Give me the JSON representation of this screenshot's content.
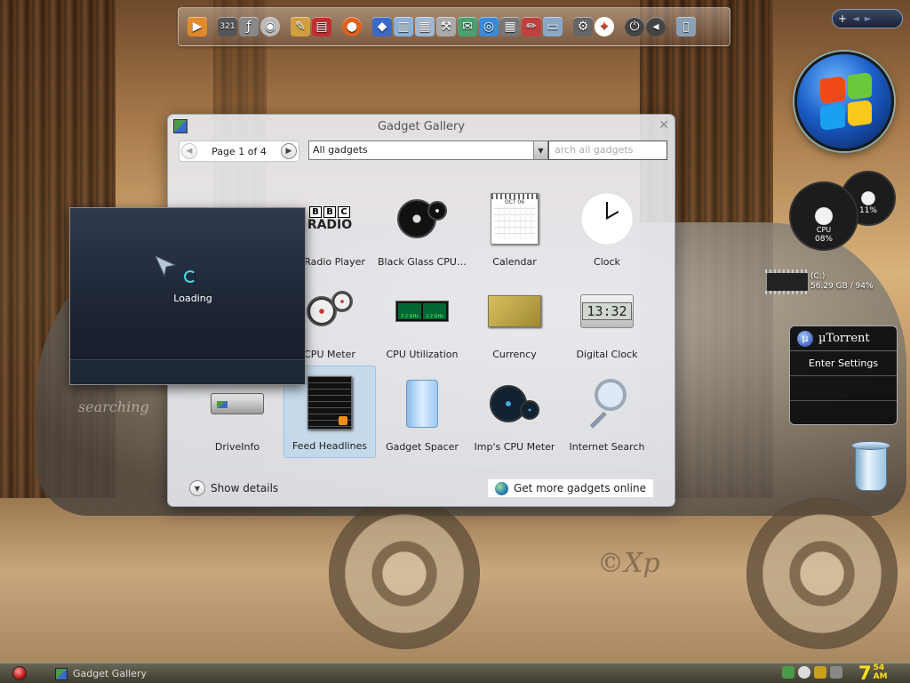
{
  "desktop": {
    "watermark": "©Xp",
    "graffiti": "searching"
  },
  "dock": {
    "items": [
      "media-player",
      "321-player",
      "flash",
      "dvd",
      "paint",
      "books",
      "firefox",
      "explorer",
      "notes",
      "documents",
      "tools",
      "chat",
      "internet",
      "calculator",
      "editor",
      "display",
      "settings",
      "windows",
      "power",
      "volume",
      "recycle"
    ]
  },
  "mini_bar": {
    "add_label": "+",
    "prev_label": "◄",
    "next_label": "►"
  },
  "gauges": {
    "cpu_label": "CPU",
    "cpu_value": "08%",
    "mem_value": "11%"
  },
  "drive": {
    "name": "(C:)",
    "info": "56.29 GB / 94%"
  },
  "utorrent": {
    "title": "µTorrent",
    "logo": "µ",
    "settings_label": "Enter Settings"
  },
  "gallery": {
    "title": "Gadget Gallery",
    "pager_text": "Page 1 of 4",
    "filter_value": "All gadgets",
    "search_placeholder": "arch all gadgets",
    "tiles": [
      {
        "label": "",
        "icon": "blank-icon",
        "selected": false
      },
      {
        "label": "C Radio Player",
        "icon": "bbc-radio-icon",
        "selected": false
      },
      {
        "label": "Black Glass CPU ...",
        "icon": "cpu-gauge-icon",
        "selected": false
      },
      {
        "label": "Calendar",
        "icon": "calendar-icon",
        "selected": false
      },
      {
        "label": "Clock",
        "icon": "clock-icon",
        "selected": false
      },
      {
        "label": "",
        "icon": "blank-icon",
        "selected": false
      },
      {
        "label": "CPU Meter",
        "icon": "cpu-meter-icon",
        "selected": false
      },
      {
        "label": "CPU Utilization",
        "icon": "cpu-utilization-icon",
        "selected": false
      },
      {
        "label": "Currency",
        "icon": "currency-icon",
        "selected": false
      },
      {
        "label": "Digital Clock",
        "icon": "digital-clock-icon",
        "selected": false
      },
      {
        "label": "DriveInfo",
        "icon": "drive-info-icon",
        "selected": false
      },
      {
        "label": "Feed Headlines",
        "icon": "feed-headlines-icon",
        "selected": true
      },
      {
        "label": "Gadget Spacer",
        "icon": "gadget-spacer-icon",
        "selected": false
      },
      {
        "label": "Imp's CPU Meter",
        "icon": "imps-cpu-meter-icon",
        "selected": false
      },
      {
        "label": "Internet Search",
        "icon": "internet-search-icon",
        "selected": false
      }
    ],
    "bbc_letters": [
      "B",
      "B",
      "C"
    ],
    "bbc_word": "RADIO",
    "calendar_month": "OCT 06",
    "digital_clock_time": "13:32",
    "cpu_util_readout": [
      "2.2 GHz",
      "2.2 GHz"
    ],
    "show_details_label": "Show details",
    "get_more_label": "Get more gadgets online"
  },
  "loading": {
    "text": "Loading"
  },
  "taskbar": {
    "task_label": "Gadget Gallery",
    "clock_hour": "7",
    "clock_minute": "54",
    "clock_ampm": "AM"
  },
  "colors": {
    "accent": "#3a6ac8",
    "clock": "#ffe21a",
    "loading_spinner": "#4ad4e6"
  }
}
